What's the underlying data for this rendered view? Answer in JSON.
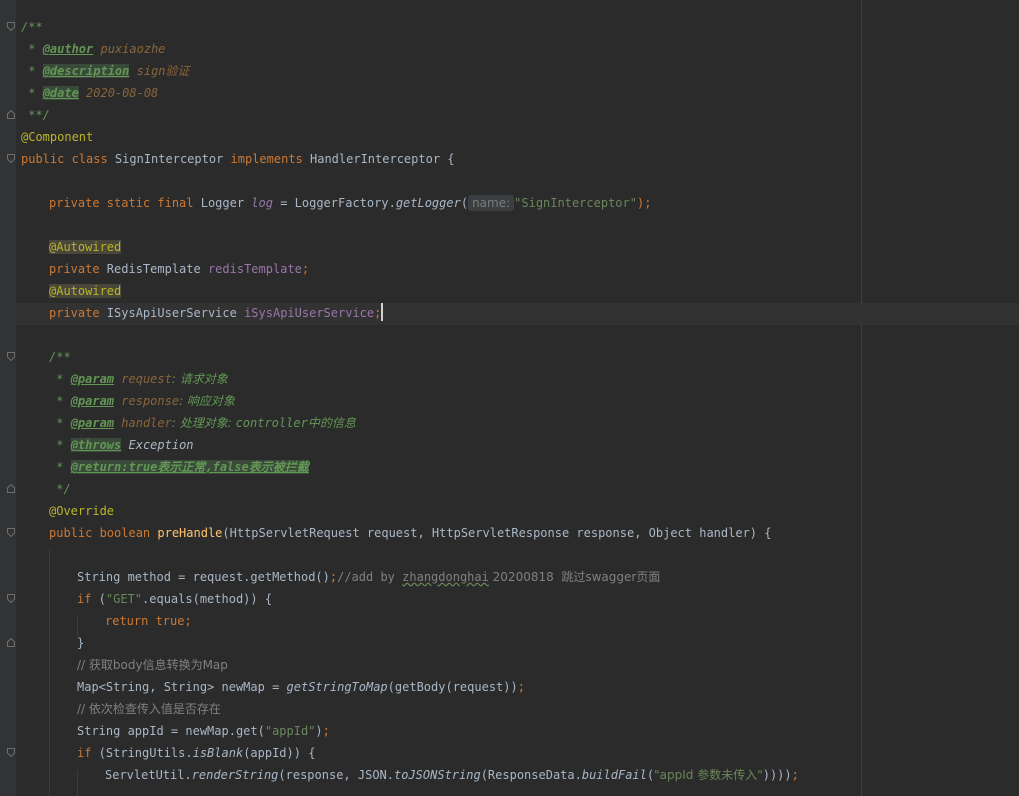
{
  "editor": {
    "colors": {
      "background": "#2b2b2b",
      "gutter": "#313335",
      "keyword": "#cc7832",
      "annotation": "#bbb529",
      "javadoc": "#629755",
      "field": "#9876aa",
      "method_decl": "#ffc66d",
      "string": "#6a8759",
      "comment": "#808080",
      "text": "#a9b7c6"
    },
    "hint_name": "name:",
    "lines": {
      "l1": "/**",
      "l2_star": " * ",
      "l2_tag": "@author",
      "l2_val": " puxiaozhe",
      "l3_star": " * ",
      "l3_tag": "@description",
      "l3_val": " sign验证",
      "l4_star": " * ",
      "l4_tag": "@date",
      "l4_val": " 2020-08-08",
      "l5": " **/",
      "l6": "@Component",
      "l7_kw": "public class",
      "l7_name": " SignInterceptor ",
      "l7_kw2": "implements",
      "l7_rest": " HandlerInterceptor {",
      "l9_kw": "private static final",
      "l9_type": " Logger ",
      "l9_field": "log",
      "l9_eq": " = LoggerFactory.",
      "l9_fn": "getLogger",
      "l9_open": "(",
      "l9_str": "\"SignInterceptor\"",
      "l9_close": ");",
      "l11": "@Autowired",
      "l12_kw": "private",
      "l12_type": " RedisTemplate ",
      "l12_field": "redisTemplate",
      "l12_semi": ";",
      "l13": "@Autowired",
      "l14_kw": "private",
      "l14_type": " ISysApiUserService ",
      "l14_field": "iSysApiUserService",
      "l14_semi": ";",
      "l16": "/**",
      "l17_star": " * ",
      "l17_tag": "@param",
      "l17_name": " request",
      "l17_desc": ": 请求对象",
      "l18_star": " * ",
      "l18_tag": "@param",
      "l18_name": " response",
      "l18_desc": ": 响应对象",
      "l19_star": " * ",
      "l19_tag": "@param",
      "l19_name": " handler",
      "l19_desc1": ": 处理对象: ",
      "l19_ctrl": "controller",
      "l19_desc2": "中的信息",
      "l20_star": " * ",
      "l20_tag": "@throws",
      "l20_val": " Exception",
      "l21_star": " * ",
      "l21_tag": "@return:true表示正常,false表示被拦截",
      "l22": " */",
      "l23": "@Override",
      "l24_kw": "public boolean",
      "l24_fn": " preHandle",
      "l24_rest": "(HttpServletRequest request, HttpServletResponse response, Object handler) {",
      "l26_code": "String method = request.getMethod()",
      "l26_semi": ";",
      "l26_cmt1": "//add by ",
      "l26_user": "zhangdonghai",
      "l26_cmt2": " 20200818  跳过swagger页面",
      "l27_kw": "if",
      "l27_a": " (",
      "l27_str": "\"GET\"",
      "l27_b": ".equals(method)) {",
      "l28_kw": "return true",
      "l28_semi": ";",
      "l29": "}",
      "l30": "// 获取body信息转换为Map",
      "l31_a": "Map<String, String> newMap = ",
      "l31_fn": "getStringToMap",
      "l31_b": "(getBody(request))",
      "l31_semi": ";",
      "l32": "// 依次检查传入值是否存在",
      "l33_a": "String appId = newMap.get(",
      "l33_str": "\"appId\"",
      "l33_b": ")",
      "l33_semi": ";",
      "l34_kw": "if",
      "l34_a": " (StringUtils.",
      "l34_fn": "isBlank",
      "l34_b": "(appId)) {",
      "l35_a": "ServletUtil.",
      "l35_fn1": "renderString",
      "l35_b": "(response, JSON.",
      "l35_fn2": "toJSONString",
      "l35_c": "(ResponseData.",
      "l35_fn3": "buildFail",
      "l35_d": "(",
      "l35_str": "\"appId 参数未传入\"",
      "l35_e": "))))",
      "l35_semi": ";"
    }
  }
}
